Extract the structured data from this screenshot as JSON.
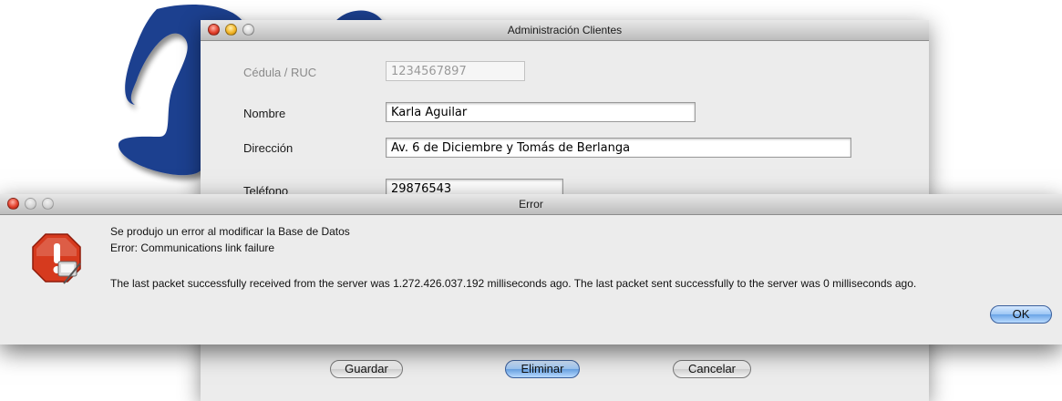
{
  "admin_window": {
    "title": "Administración Clientes",
    "fields": {
      "cedula": {
        "label": "Cédula / RUC",
        "value": "1234567897"
      },
      "nombre": {
        "label": "Nombre",
        "value": "Karla Aguilar"
      },
      "direccion": {
        "label": "Dirección",
        "value": "Av. 6 de Diciembre y Tomás de Berlanga"
      },
      "telefono": {
        "label": "Teléfono",
        "value": "29876543"
      }
    },
    "buttons": {
      "guardar": "Guardar",
      "eliminar": "Eliminar",
      "cancelar": "Cancelar"
    }
  },
  "error_dialog": {
    "title": "Error",
    "line1": "Se produjo un error al modificar la Base de Datos",
    "line2": "Error: Communications link failure",
    "line3": "The last packet successfully received from the server was 1.272.426.037.192 milliseconds ago.  The last packet sent successfully to the server was 0 milliseconds ago.",
    "ok_label": "OK",
    "icon": "stop-alert-icon"
  },
  "colors": {
    "logo_blue": "#1f3f8f",
    "default_button": "#6aa4e6"
  }
}
